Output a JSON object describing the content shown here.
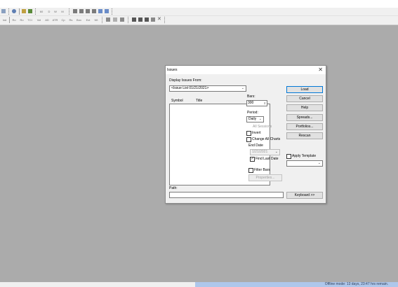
{
  "toolbar1": {
    "labels": [
      "D",
      "W",
      "M"
    ],
    "count": "60"
  },
  "toolbar2": {
    "labels": [
      "Ind",
      "Ro",
      "Ro",
      "TCI",
      "Vol",
      "AD",
      "ATR",
      "Cp",
      "Rs",
      "Box",
      "Ext",
      "Wt"
    ]
  },
  "status": {
    "text": "Offline mode: 13 days, 23:47 hrs remain."
  },
  "dialog": {
    "title": "Issues",
    "display_from_label": "Display Issues From:",
    "source_value": "<Issue List 01/21/2021>",
    "col_symbol": "Symbol",
    "col_title": "Title",
    "bars_label": "Bars:",
    "bars_value": "300",
    "period_label": "Period:",
    "period_value": "Daily",
    "sessions_value": "All Sessions",
    "invert_label": "Invert",
    "change_all_label": "Change All Charts",
    "end_date_label": "End Date",
    "end_date_value": "1/21/2021",
    "find_last_label": "Find Last Date",
    "filter_bars_label": "Filter Bars",
    "properties_label": "Properties...",
    "apply_template_label": "Apply Template",
    "path_label": "Path:",
    "buttons": {
      "load": "Load",
      "cancel": "Cancel",
      "help": "Help",
      "spreads": "Spreads...",
      "portfolios": "Portfolios...",
      "rescan": "Rescan",
      "keyboard": "Keyboard >>"
    }
  }
}
